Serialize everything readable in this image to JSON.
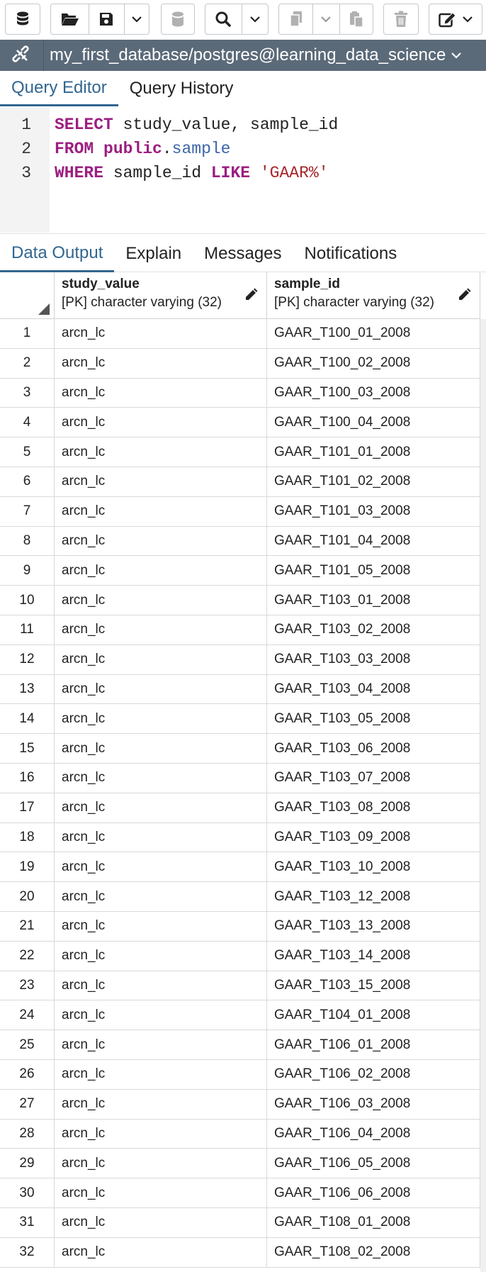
{
  "toolbar": {
    "buttons": [
      {
        "icon": "database-stack-icon"
      },
      {
        "icon": "folder-open-icon"
      },
      {
        "icon": "save-icon"
      },
      {
        "icon": "chevron-down-icon"
      },
      {
        "icon": "database-icon"
      },
      {
        "icon": "search-icon"
      },
      {
        "icon": "copy-icon"
      },
      {
        "icon": "paste-icon"
      },
      {
        "icon": "trash-icon"
      },
      {
        "icon": "edit-icon"
      }
    ]
  },
  "connection": {
    "label": "my_first_database/postgres@learning_data_science",
    "bar_color": "#5b6a79"
  },
  "editor_tabs": [
    {
      "label": "Query Editor",
      "active": true
    },
    {
      "label": "Query History",
      "active": false
    }
  ],
  "query": {
    "lines": [
      {
        "num": "1",
        "kw1": "SELECT",
        "text1": " study_value, sample_id"
      },
      {
        "num": "2",
        "kw1": "FROM",
        "schema": "public",
        "dot": ".",
        "table": "sample"
      },
      {
        "num": "3",
        "kw1": "WHERE",
        "text1": " sample_id ",
        "kw2": "LIKE",
        "string": "'GAAR%'"
      }
    ]
  },
  "output_tabs": [
    {
      "label": "Data Output",
      "active": true
    },
    {
      "label": "Explain",
      "active": false
    },
    {
      "label": "Messages",
      "active": false
    },
    {
      "label": "Notifications",
      "active": false
    }
  ],
  "grid": {
    "columns": [
      {
        "name": "study_value",
        "type": "[PK] character varying (32)"
      },
      {
        "name": "sample_id",
        "type": "[PK] character varying (32)"
      }
    ],
    "rows": [
      [
        "1",
        "arcn_lc",
        "GAAR_T100_01_2008"
      ],
      [
        "2",
        "arcn_lc",
        "GAAR_T100_02_2008"
      ],
      [
        "3",
        "arcn_lc",
        "GAAR_T100_03_2008"
      ],
      [
        "4",
        "arcn_lc",
        "GAAR_T100_04_2008"
      ],
      [
        "5",
        "arcn_lc",
        "GAAR_T101_01_2008"
      ],
      [
        "6",
        "arcn_lc",
        "GAAR_T101_02_2008"
      ],
      [
        "7",
        "arcn_lc",
        "GAAR_T101_03_2008"
      ],
      [
        "8",
        "arcn_lc",
        "GAAR_T101_04_2008"
      ],
      [
        "9",
        "arcn_lc",
        "GAAR_T101_05_2008"
      ],
      [
        "10",
        "arcn_lc",
        "GAAR_T103_01_2008"
      ],
      [
        "11",
        "arcn_lc",
        "GAAR_T103_02_2008"
      ],
      [
        "12",
        "arcn_lc",
        "GAAR_T103_03_2008"
      ],
      [
        "13",
        "arcn_lc",
        "GAAR_T103_04_2008"
      ],
      [
        "14",
        "arcn_lc",
        "GAAR_T103_05_2008"
      ],
      [
        "15",
        "arcn_lc",
        "GAAR_T103_06_2008"
      ],
      [
        "16",
        "arcn_lc",
        "GAAR_T103_07_2008"
      ],
      [
        "17",
        "arcn_lc",
        "GAAR_T103_08_2008"
      ],
      [
        "18",
        "arcn_lc",
        "GAAR_T103_09_2008"
      ],
      [
        "19",
        "arcn_lc",
        "GAAR_T103_10_2008"
      ],
      [
        "20",
        "arcn_lc",
        "GAAR_T103_12_2008"
      ],
      [
        "21",
        "arcn_lc",
        "GAAR_T103_13_2008"
      ],
      [
        "22",
        "arcn_lc",
        "GAAR_T103_14_2008"
      ],
      [
        "23",
        "arcn_lc",
        "GAAR_T103_15_2008"
      ],
      [
        "24",
        "arcn_lc",
        "GAAR_T104_01_2008"
      ],
      [
        "25",
        "arcn_lc",
        "GAAR_T106_01_2008"
      ],
      [
        "26",
        "arcn_lc",
        "GAAR_T106_02_2008"
      ],
      [
        "27",
        "arcn_lc",
        "GAAR_T106_03_2008"
      ],
      [
        "28",
        "arcn_lc",
        "GAAR_T106_04_2008"
      ],
      [
        "29",
        "arcn_lc",
        "GAAR_T106_05_2008"
      ],
      [
        "30",
        "arcn_lc",
        "GAAR_T106_06_2008"
      ],
      [
        "31",
        "arcn_lc",
        "GAAR_T108_01_2008"
      ],
      [
        "32",
        "arcn_lc",
        "GAAR_T108_02_2008"
      ]
    ]
  },
  "colors": {
    "accent": "#326690",
    "keyword": "#9c1e81",
    "table": "#3d65a8",
    "string": "#a5282a"
  }
}
